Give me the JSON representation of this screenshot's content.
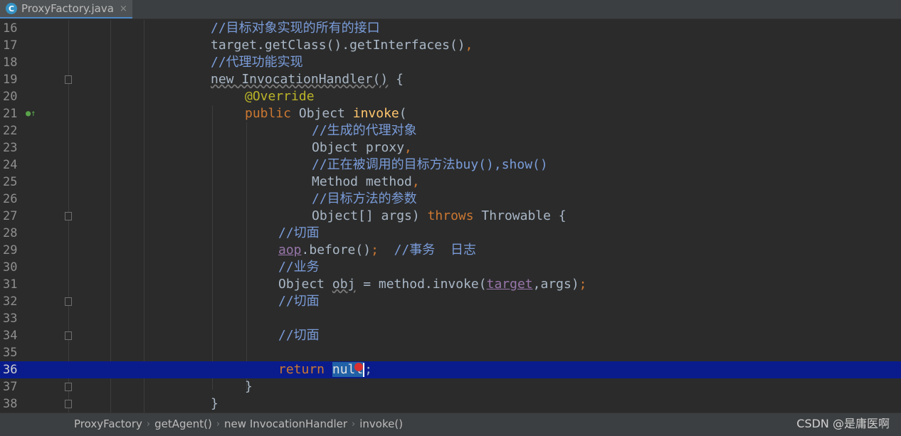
{
  "tab": {
    "icon": "C",
    "title": "ProxyFactory.java",
    "close": "×"
  },
  "lines": [
    {
      "n": "16",
      "t": "//目标对象实现的所有的接口"
    },
    {
      "n": "17",
      "a": "target.getClass().getInterfaces()",
      "b": ","
    },
    {
      "n": "18",
      "t": "//代理功能实现"
    },
    {
      "n": "19",
      "a": "new InvocationHandler()",
      "b": " {"
    },
    {
      "n": "20",
      "t": "@Override"
    },
    {
      "n": "21",
      "a": "public",
      "b": " Object ",
      "c": "invoke",
      "d": "("
    },
    {
      "n": "22",
      "t": "//生成的代理对象"
    },
    {
      "n": "23",
      "a": "Object proxy",
      "b": ","
    },
    {
      "n": "24",
      "a": "//正在被调用的目标方法",
      "b": "buy(),show()"
    },
    {
      "n": "25",
      "a": "Method method",
      "b": ","
    },
    {
      "n": "26",
      "t": "//目标方法的参数"
    },
    {
      "n": "27",
      "a": "Object[] args) ",
      "b": "throws",
      "c": " Throwable {"
    },
    {
      "n": "28",
      "t": "//切面"
    },
    {
      "n": "29",
      "a": "aop",
      "b": ".before()",
      "c": ";",
      "d": "//事务  日志"
    },
    {
      "n": "30",
      "t": "//业务"
    },
    {
      "n": "31",
      "a": "Object ",
      "b": "obj",
      "c": " = method.invoke(",
      "d": "target",
      "e": ",args)",
      "f": ";"
    },
    {
      "n": "32",
      "t": "//切面"
    },
    {
      "n": "33",
      "t": ""
    },
    {
      "n": "34",
      "t": "//切面"
    },
    {
      "n": "35",
      "t": ""
    },
    {
      "n": "36",
      "a": "return ",
      "b": "null",
      "c": ";"
    },
    {
      "n": "37",
      "t": "}"
    },
    {
      "n": "38",
      "t": "}"
    }
  ],
  "breadcrumbs": [
    "ProxyFactory",
    "getAgent()",
    "new InvocationHandler",
    "invoke()"
  ],
  "breadcrumb_sep": "›",
  "watermark": "CSDN @是庸医啊",
  "gutter": {
    "override_icon": "implements-method-icon",
    "override_glyph": "●↑"
  },
  "colors": {
    "keyword": "#cc7832",
    "comment": "#629755",
    "annotation": "#bbb529",
    "method": "#ffc66d",
    "field": "#9876aa",
    "current_line": "#0a1c8c"
  }
}
